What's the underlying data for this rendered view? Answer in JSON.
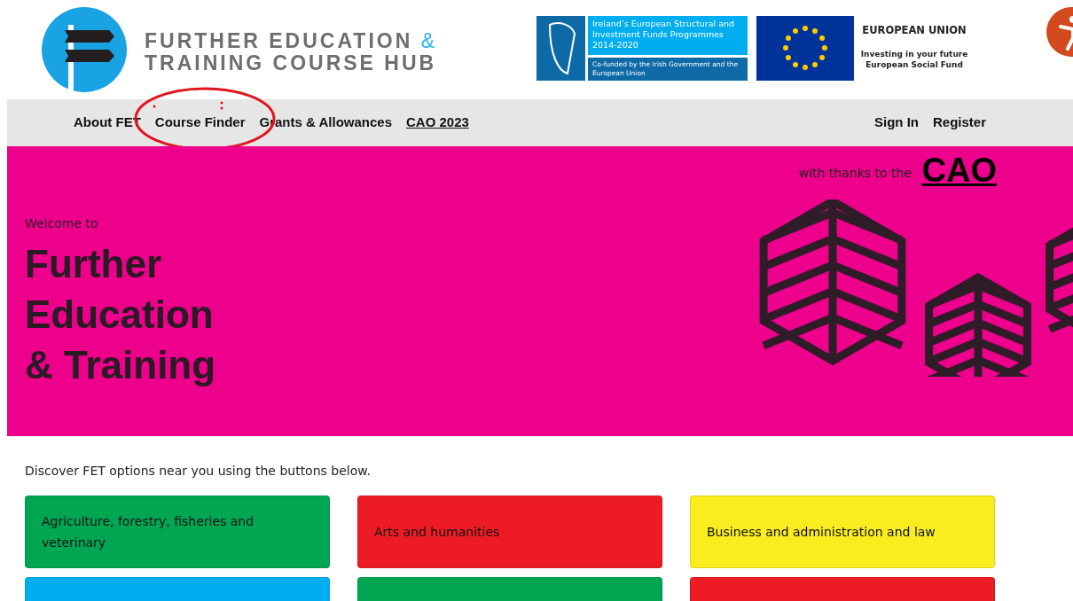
{
  "logo": {
    "line1": "FURTHER EDUCATION",
    "amp": "&",
    "line2": "TRAINING COURSE HUB"
  },
  "partners": {
    "ireland_title": "Ireland’s European Structural and Investment Funds Programmes 2014-2020",
    "ireland_sub": "Co-funded by the Irish Government and the European Union",
    "eu_title": "EUROPEAN UNION",
    "eu_line1": "Investing in your future",
    "eu_line2": "European Social Fund"
  },
  "nav": {
    "left": [
      {
        "label": "About FET",
        "underlined": false
      },
      {
        "label": "Course Finder",
        "underlined": false
      },
      {
        "label": "Grants & Allowances",
        "underlined": false
      },
      {
        "label": "CAO 2023",
        "underlined": true
      }
    ],
    "right": [
      {
        "label": "Sign In"
      },
      {
        "label": "Register"
      }
    ]
  },
  "annotation": {
    "kind": "circle",
    "color": "#e0161e"
  },
  "hero": {
    "credit": "with thanks to the",
    "credit_brand": "CAO",
    "welcome": "Welcome to",
    "title_lines": [
      "Further",
      "Education",
      "& Training"
    ]
  },
  "intro": "Discover FET options near you using the buttons below.",
  "categories": [
    {
      "label": "Agriculture, forestry, fisheries and veterinary",
      "color": "#00a651"
    },
    {
      "label": "Arts and humanities",
      "color": "#ed1c24"
    },
    {
      "label": "Business and administration and law",
      "color": "#f9ec1f"
    },
    {
      "color": "#00aeef"
    },
    {
      "color": "#00a651"
    },
    {
      "color": "#ed1c24"
    }
  ]
}
